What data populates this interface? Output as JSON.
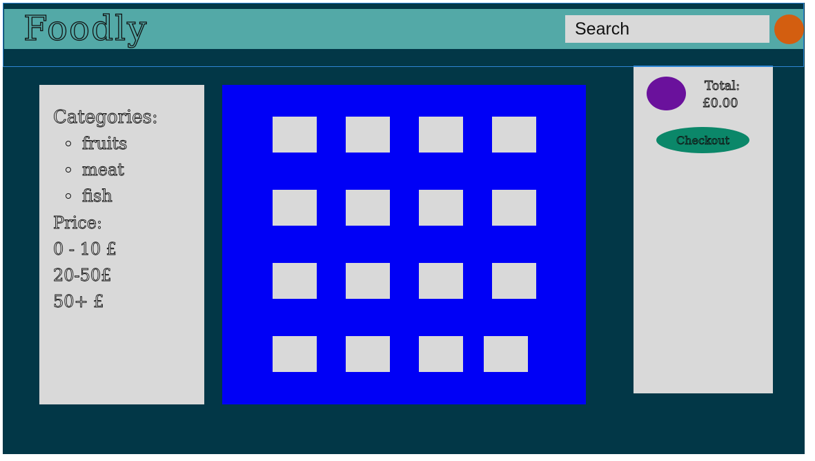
{
  "header": {
    "logo": "Foodly",
    "search_placeholder": "Search"
  },
  "sidebar": {
    "categories_heading": "Categories:",
    "categories": [
      "fruits",
      "meat",
      "fish"
    ],
    "price_heading": "Price:",
    "price_ranges": [
      "0 - 10 £",
      "20-50£",
      "50+ £"
    ]
  },
  "products": {
    "rows": 4,
    "columns": 4,
    "count": 16
  },
  "cart": {
    "total_label": "Total:",
    "total_value": "£0.00",
    "checkout_label": "Checkout"
  },
  "colors": {
    "page_background": "#023747",
    "header_band": "#53a9a7",
    "search_background": "#d9d9d9",
    "profile_dot": "#d35e10",
    "sidebar_background": "#d9d9d9",
    "product_grid_background": "#0000f6",
    "product_tile": "#d9d9d9",
    "cart_icon": "#6a119c",
    "checkout_button": "#0b8769"
  }
}
